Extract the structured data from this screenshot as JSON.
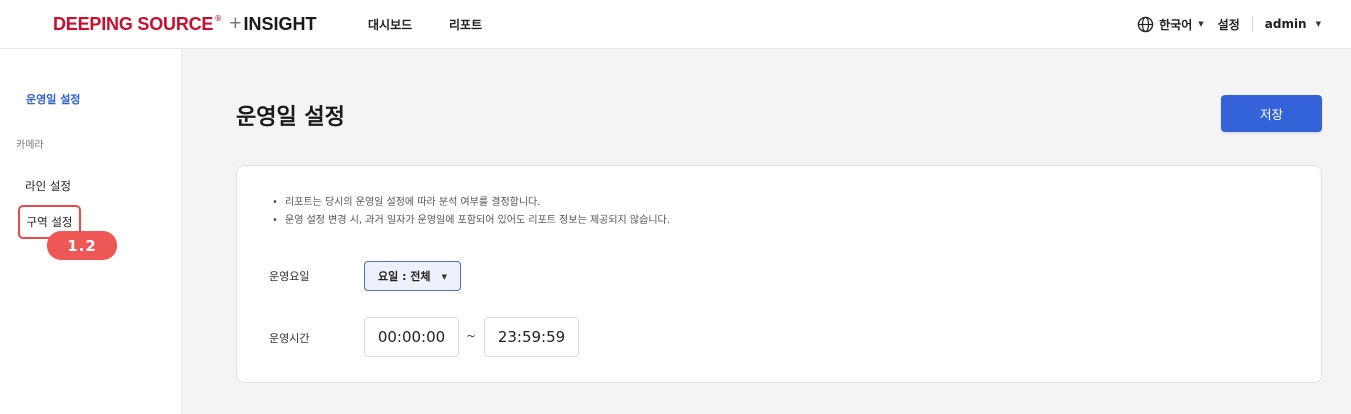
{
  "header": {
    "logo_main": "DEEPING SOURCE",
    "logo_reg": "®",
    "logo_plus": "+",
    "logo_insight": "INSIGHT",
    "nav": [
      "대시보드",
      "리포트"
    ],
    "language": "한국어",
    "settings": "설정",
    "user": "admin"
  },
  "sidebar": {
    "active_item": "운영일 설정",
    "section": "카메라",
    "items": [
      "라인 설정",
      "구역 설정"
    ],
    "badge": "1.2"
  },
  "main": {
    "title": "운영일 설정",
    "save_label": "저장",
    "notes": [
      "리포트는 당시의 운영일 설정에 따라 분석 여부를 결정합니다.",
      "운영 설정 변경 시, 과거 일자가 운영일에 포함되어 있어도 리포트 정보는 제공되지 않습니다."
    ],
    "days_label": "운영요일",
    "days_value": "요일 : 전체",
    "time_label": "운영시간",
    "time_start": "00:00:00",
    "time_separator": "~",
    "time_end": "23:59:59"
  },
  "colors": {
    "brand_red": "#c8102e",
    "primary_blue": "#3462d8",
    "active_blue": "#2f5fd0",
    "highlight_red": "#ef5656"
  },
  "icons": {
    "language": "globe-icon",
    "dropdown": "caret-down-icon"
  }
}
